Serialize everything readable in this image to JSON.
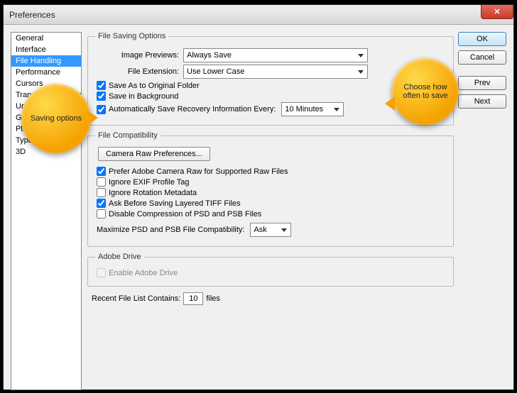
{
  "window": {
    "title": "Preferences"
  },
  "sidebar": {
    "items": [
      {
        "label": "General"
      },
      {
        "label": "Interface"
      },
      {
        "label": "File Handling"
      },
      {
        "label": "Performance"
      },
      {
        "label": "Cursors"
      },
      {
        "label": "Transparency & Gamut"
      },
      {
        "label": "Units & Rulers"
      },
      {
        "label": "Guides, Grid & Slices"
      },
      {
        "label": "Plug-Ins"
      },
      {
        "label": "Type"
      },
      {
        "label": "3D"
      }
    ],
    "selected_index": 2
  },
  "buttons": {
    "ok": "OK",
    "cancel": "Cancel",
    "prev": "Prev",
    "next": "Next"
  },
  "file_saving": {
    "legend": "File Saving Options",
    "image_previews_label": "Image Previews:",
    "image_previews_value": "Always Save",
    "file_extension_label": "File Extension:",
    "file_extension_value": "Use Lower Case",
    "save_as_original": "Save As to Original Folder",
    "save_in_background": "Save in Background",
    "auto_save_label": "Automatically Save Recovery Information Every:",
    "auto_save_value": "10 Minutes"
  },
  "file_compat": {
    "legend": "File Compatibility",
    "camera_raw_btn": "Camera Raw Preferences...",
    "prefer_acr": "Prefer Adobe Camera Raw for Supported Raw Files",
    "ignore_exif": "Ignore EXIF Profile Tag",
    "ignore_rotation": "Ignore Rotation Metadata",
    "ask_tiff": "Ask Before Saving Layered TIFF Files",
    "disable_compress": "Disable Compression of PSD and PSB Files",
    "maximize_label": "Maximize PSD and PSB File Compatibility:",
    "maximize_value": "Ask"
  },
  "adobe_drive": {
    "legend": "Adobe Drive",
    "enable": "Enable Adobe Drive"
  },
  "recent": {
    "prefix": "Recent File List Contains:",
    "value": "10",
    "suffix": "files"
  },
  "callouts": {
    "saving_options": "Saving options",
    "choose_often": "Choose how often to save"
  }
}
